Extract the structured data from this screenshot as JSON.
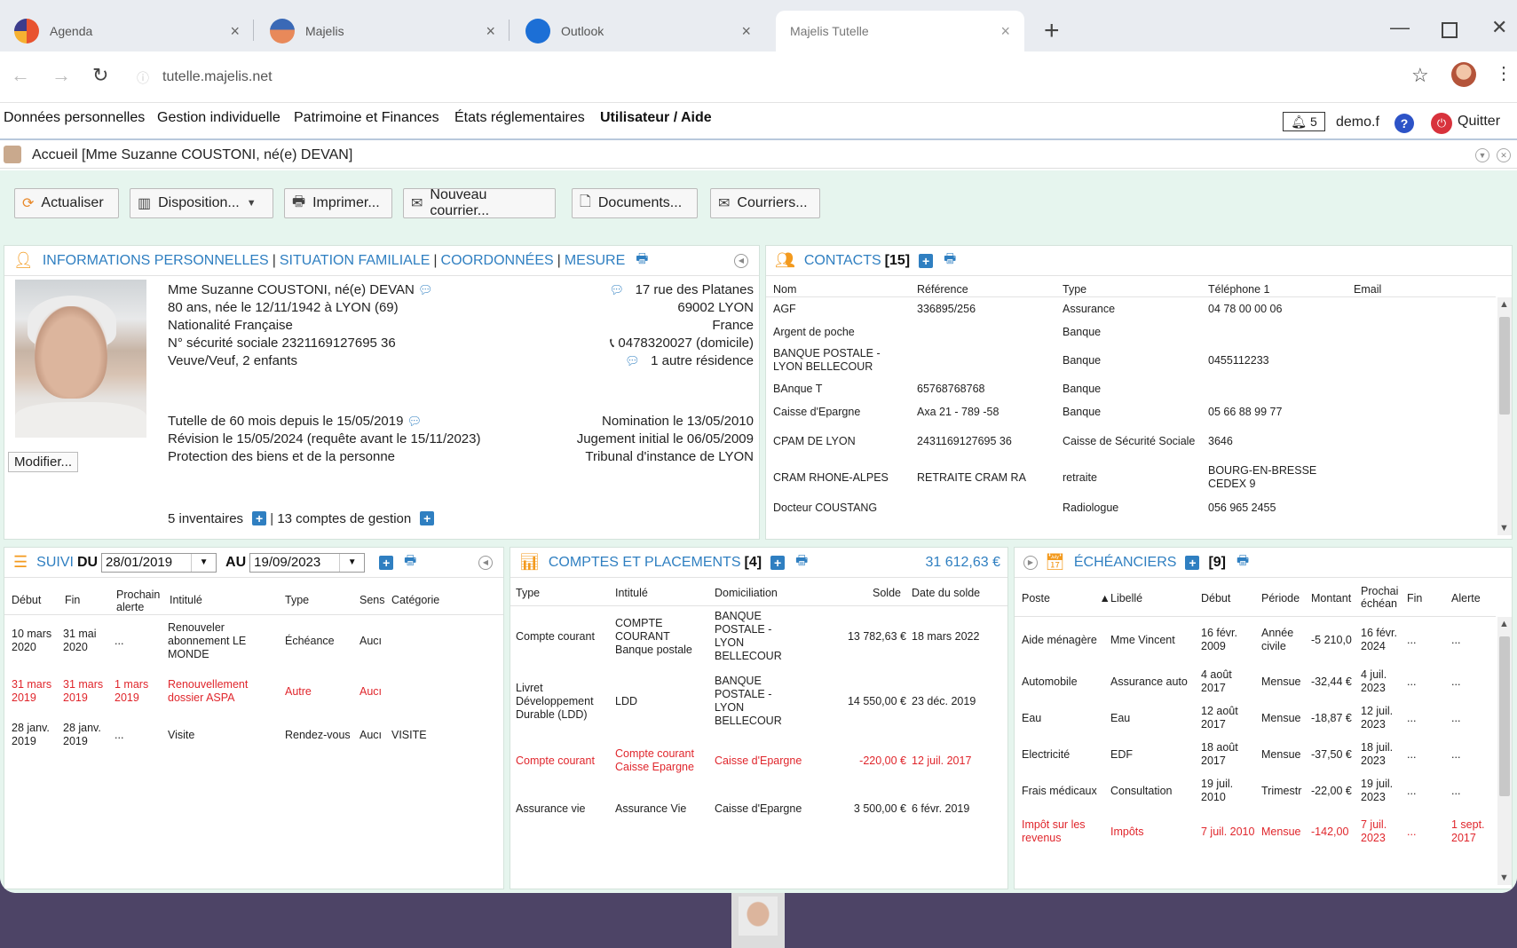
{
  "browser": {
    "tabs": [
      {
        "title": "Agenda",
        "color": "#e8532f"
      },
      {
        "title": "Majelis",
        "color": "#e8895a"
      },
      {
        "title": "Outlook",
        "color": "#1c6fd6"
      },
      {
        "title": "Majelis Tutelle",
        "color": ""
      }
    ],
    "url": "tutelle.majelis.net"
  },
  "menu": {
    "items": [
      "Données personnelles",
      "Gestion individuelle",
      "Patrimoine et Finances",
      "États réglementaires",
      "Utilisateur / Aide"
    ],
    "notifications": "5",
    "user": "demo.f",
    "quit": "Quitter"
  },
  "breadcrumb": "Accueil [Mme Suzanne COUSTONI, né(e) DEVAN]",
  "toolbar": {
    "refresh": "Actualiser",
    "layout": "Disposition...",
    "print": "Imprimer...",
    "new_mail": "Nouveau courrier...",
    "documents": "Documents...",
    "mails": "Courriers..."
  },
  "info": {
    "tabs": [
      "INFORMATIONS PERSONNELLES",
      "SITUATION FAMILIALE",
      "COORDONNÉES",
      "MESURE"
    ],
    "name": "Mme Suzanne COUSTONI, né(e) DEVAN",
    "birth": "80 ans, née le 12/11/1942 à LYON (69)",
    "nationality": "Nationalité Française",
    "ssn": "N° sécurité sociale 2321169127695 36",
    "family": "Veuve/Veuf, 2 enfants",
    "street": "17 rue des Platanes",
    "city": "69002 LYON",
    "country": "France",
    "phone": "0478320027 (domicile)",
    "other_residence": "1 autre résidence",
    "measure": "Tutelle de 60 mois depuis le 15/05/2019",
    "revision": "Révision le 15/05/2024 (requête avant le 15/11/2023)",
    "protection": "Protection des biens et de la personne",
    "nomination": "Nomination le 13/05/2010",
    "judgment": "Jugement initial le 06/05/2009",
    "court": "Tribunal d'instance de LYON",
    "modify": "Modifier...",
    "inventories": "5 inventaires",
    "accounts": "13 comptes de gestion"
  },
  "contacts": {
    "title": "CONTACTS",
    "count": "[15]",
    "headers": [
      "Nom",
      "Référence",
      "Type",
      "Téléphone 1",
      "Email"
    ],
    "rows": [
      [
        "AGF",
        "336895/256",
        "Assurance",
        "04 78 00 00 06",
        ""
      ],
      [
        "Argent de poche",
        "",
        "Banque",
        "",
        ""
      ],
      [
        "BANQUE POSTALE - LYON BELLECOUR",
        "",
        "Banque",
        "0455112233",
        ""
      ],
      [
        "BAnque T",
        "65768768768",
        "Banque",
        "",
        ""
      ],
      [
        "Caisse d'Epargne",
        "Axa 21 - 789 -58",
        "Banque",
        "05 66 88 99 77",
        ""
      ],
      [
        "CPAM DE LYON",
        "2431169127695 36",
        "Caisse de Sécurité Sociale",
        "3646",
        ""
      ],
      [
        "CRAM RHONE-ALPES",
        "RETRAITE CRAM RA",
        "retraite",
        "BOURG-EN-BRESSE CEDEX 9",
        ""
      ],
      [
        "Docteur COUSTANG",
        "",
        "Radiologue",
        "056 965 2455",
        ""
      ]
    ]
  },
  "suivi": {
    "title": "SUIVI",
    "du": "DU",
    "from": "28/01/2019",
    "au": "AU",
    "to": "19/09/2023",
    "headers": [
      "Début",
      "Fin",
      "Prochain alerte",
      "Intitulé",
      "Type",
      "Sens",
      "Catégorie"
    ],
    "rows": [
      [
        "10 mars 2020",
        "31 mai 2020",
        "...",
        "Renouveler abonnement LE MONDE",
        "Échéance",
        "Aucı",
        ""
      ],
      [
        "31 mars 2019",
        "31 mars 2019",
        "1 mars 2019",
        "Renouvellement dossier ASPA",
        "Autre",
        "Aucı",
        ""
      ],
      [
        "28 janv. 2019",
        "28 janv. 2019",
        "...",
        "Visite",
        "Rendez-vous",
        "Aucı",
        "VISITE"
      ]
    ]
  },
  "comptes": {
    "title": "COMPTES ET PLACEMENTS",
    "count": "[4]",
    "total": "31 612,63 €",
    "headers": [
      "Type",
      "Intitulé",
      "Domiciliation",
      "Solde",
      "Date du solde"
    ],
    "rows": [
      [
        "Compte courant",
        "COMPTE COURANT Banque postale",
        "BANQUE POSTALE - LYON BELLECOUR",
        "13 782,63 €",
        "18 mars 2022"
      ],
      [
        "Livret Développement Durable (LDD)",
        "LDD",
        "BANQUE POSTALE - LYON BELLECOUR",
        "14 550,00 €",
        "23 déc. 2019"
      ],
      [
        "Compte courant",
        "Compte courant Caisse Epargne",
        "Caisse d'Epargne",
        "-220,00 €",
        "12 juil. 2017"
      ],
      [
        "Assurance vie",
        "Assurance Vie",
        "Caisse d'Epargne",
        "3 500,00 €",
        "6 févr. 2019"
      ]
    ]
  },
  "echeanciers": {
    "title": "ÉCHÉANCIERS",
    "count": "[9]",
    "headers": [
      "Poste",
      "Libellé",
      "Début",
      "Période",
      "Montant",
      "Prochai échéan",
      "Fin",
      "Alerte"
    ],
    "rows": [
      [
        "Aide ménagère",
        "Mme Vincent",
        "16 févr. 2009",
        "Année civile",
        "-5 210,0",
        "16 févr. 2024",
        "...",
        "..."
      ],
      [
        "Automobile",
        "Assurance auto",
        "4 août 2017",
        "Mensue",
        "-32,44 €",
        "4 juil. 2023",
        "...",
        "..."
      ],
      [
        "Eau",
        "Eau",
        "12 août 2017",
        "Mensue",
        "-18,87 €",
        "12 juil. 2023",
        "...",
        "..."
      ],
      [
        "Electricité",
        "EDF",
        "18 août 2017",
        "Mensue",
        "-37,50 €",
        "18 juil. 2023",
        "...",
        "..."
      ],
      [
        "Frais médicaux",
        "Consultation",
        "19 juil. 2010",
        "Trimestr",
        "-22,00 €",
        "19 juil. 2023",
        "...",
        "..."
      ],
      [
        "Impôt sur les revenus",
        "Impôts",
        "7 juil. 2010",
        "Mensue",
        "-142,00",
        "7 juil. 2023",
        "...",
        "1 sept. 2017"
      ]
    ]
  },
  "colors": {
    "accent": "#2f7fc1",
    "alert": "#e0262c",
    "workspace": "#e6f5ee"
  }
}
